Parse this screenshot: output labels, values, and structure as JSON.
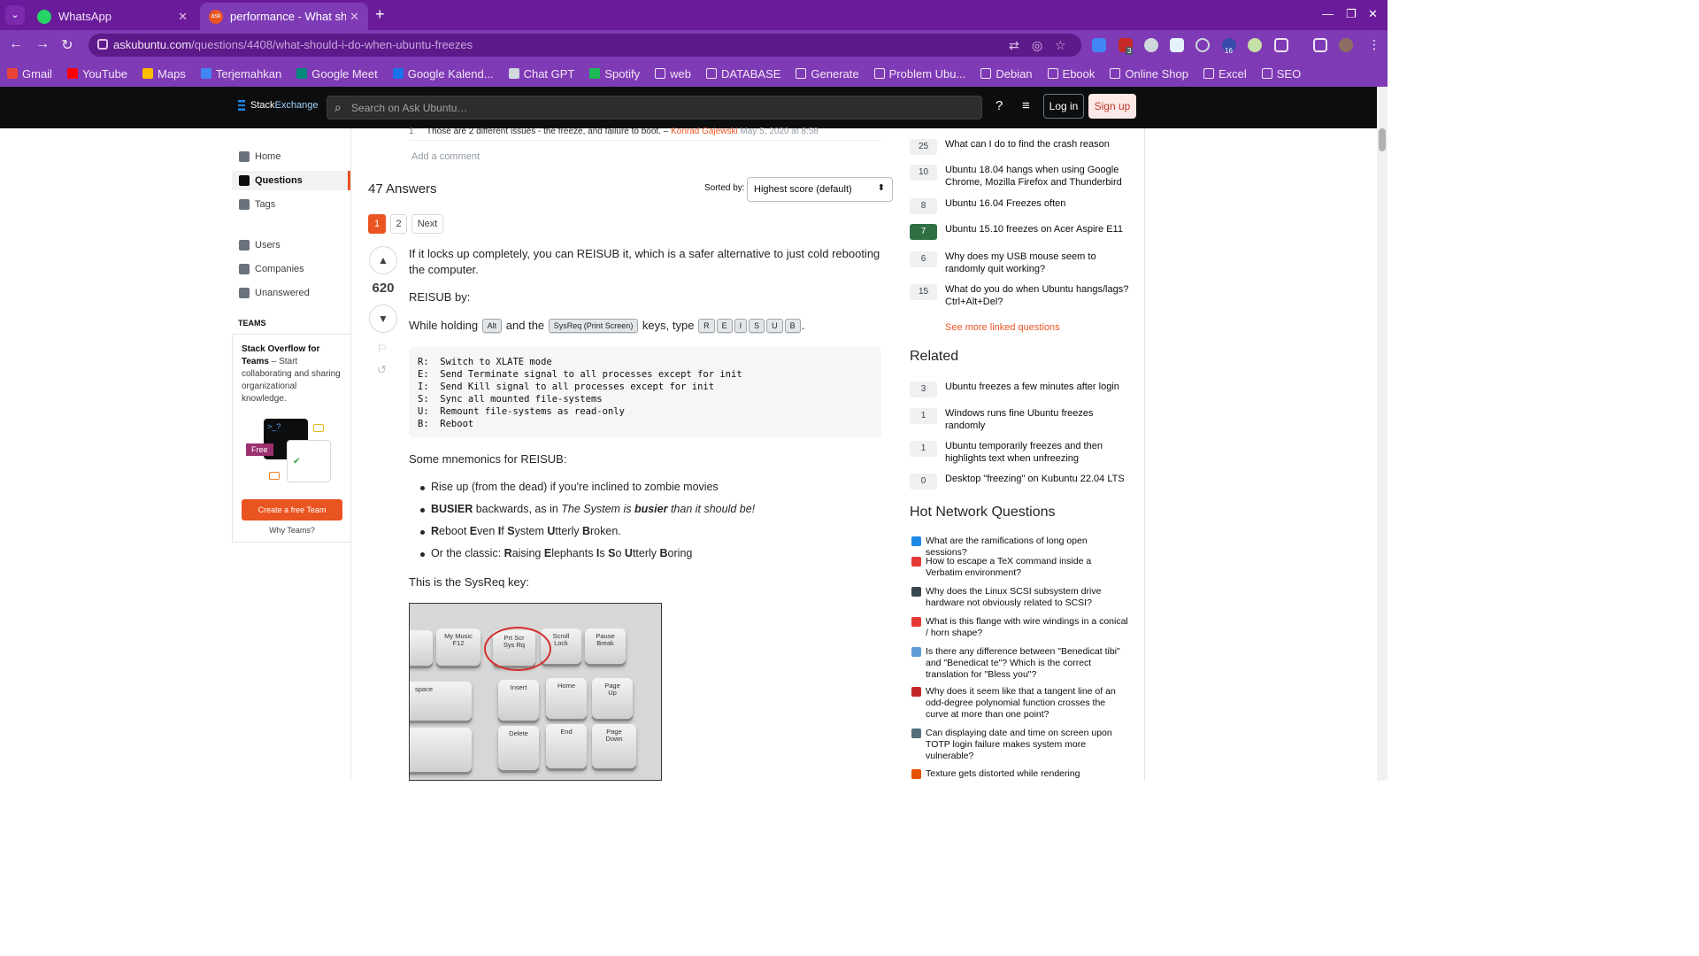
{
  "browser": {
    "tabs": [
      {
        "title": "WhatsApp",
        "active": false
      },
      {
        "title": "performance - What sho",
        "active": true
      }
    ],
    "url_host": "askubuntu.com",
    "url_path": "/questions/4408/what-should-i-do-when-ubuntu-freezes",
    "ext_badges": [
      "3",
      "16"
    ],
    "bookmarks": [
      {
        "label": "Gmail",
        "color": "#ea4335"
      },
      {
        "label": "YouTube",
        "color": "#ff0000"
      },
      {
        "label": "Maps",
        "color": "#fbbc04"
      },
      {
        "label": "Terjemahkan",
        "color": "#4285f4"
      },
      {
        "label": "Google Meet",
        "color": "#00897b"
      },
      {
        "label": "Google Kalend...",
        "color": "#1a73e8"
      },
      {
        "label": "Chat GPT",
        "color": "#cfd8dc"
      },
      {
        "label": "Spotify",
        "color": "#1db954"
      },
      {
        "label": "web",
        "folder": true
      },
      {
        "label": "DATABASE",
        "folder": true
      },
      {
        "label": "Generate",
        "folder": true
      },
      {
        "label": "Problem Ubu...",
        "folder": true
      },
      {
        "label": "Debian",
        "folder": true
      },
      {
        "label": "Ebook",
        "folder": true
      },
      {
        "label": "Online Shop",
        "folder": true
      },
      {
        "label": "Excel",
        "folder": true
      },
      {
        "label": "SEO",
        "folder": true
      }
    ]
  },
  "se": {
    "logo_stack": "Stack",
    "logo_exchange": "Exchange",
    "search_placeholder": "Search on Ask Ubuntu…",
    "login": "Log in",
    "signup": "Sign up"
  },
  "leftnav": {
    "home": "Home",
    "questions": "Questions",
    "tags": "Tags",
    "users": "Users",
    "companies": "Companies",
    "unanswered": "Unanswered",
    "teams_heading": "TEAMS",
    "teams_title": "Stack Overflow for Teams",
    "teams_body": " – Start collaborating and sharing organizational knowledge.",
    "teams_free": "Free",
    "teams_prompt": ">_?",
    "teams_button": "Create a free Team",
    "why_teams": "Why Teams?"
  },
  "comment": {
    "score": "1",
    "text": "Those are 2 different issues - the freeze, and failure to boot. – ",
    "user": "Konrad Gajewski",
    "date": " May 5, 2020 at 8:58",
    "add": "Add a comment"
  },
  "answers": {
    "heading": "47 Answers",
    "sorted_by": "Sorted by:",
    "sort_value": "Highest score (default)",
    "pages": [
      "1",
      "2",
      "Next"
    ]
  },
  "answer": {
    "votes": "620",
    "p1": "If it locks up completely, you can REISUB it, which is a safer alternative to just cold rebooting the computer.",
    "p2": "REISUB by:",
    "p3_a": "While holding ",
    "p3_b": " and the ",
    "p3_c": " keys, type ",
    "kbd_alt": "Alt",
    "kbd_sysreq": "SysReq (Print Screen)",
    "kbd_letters": [
      "R",
      "E",
      "I",
      "S",
      "U",
      "B"
    ],
    "code": "R:  Switch to XLATE mode\nE:  Send Terminate signal to all processes except for init\nI:  Send Kill signal to all processes except for init\nS:  Sync all mounted file-systems\nU:  Remount file-systems as read-only\nB:  Reboot",
    "p4": "Some mnemonics for REISUB:",
    "li1": "Rise up (from the dead) if you're inclined to zombie movies",
    "li2_busier": "BUSIER",
    "li2_rest": " backwards, as in ",
    "li2_italic1": "The System is ",
    "li2_bold": "busier",
    "li2_italic2": " than it should be!",
    "li3_parts": [
      [
        "R",
        "eboot "
      ],
      [
        "E",
        "ven "
      ],
      [
        "I",
        "f "
      ],
      [
        "S",
        "ystem "
      ],
      [
        "U",
        "tterly "
      ],
      [
        "B",
        "roken."
      ]
    ],
    "li4_prefix": "Or the classic: ",
    "li4_parts": [
      [
        "R",
        "aising "
      ],
      [
        "E",
        "lephants "
      ],
      [
        "I",
        "s "
      ],
      [
        "S",
        "o "
      ],
      [
        "U",
        "tterly "
      ],
      [
        "B",
        "oring"
      ]
    ],
    "p5": "This is the SysReq key:",
    "photo_keys": {
      "f12": "F12",
      "mymusic": "My Music",
      "prtscr": "Prt Scr\nSys Rq",
      "scroll": "Scroll\nLock",
      "pause": "Pause\nBreak",
      "space": "space",
      "insert": "Insert",
      "home": "Home",
      "pageup": "Page\nUp",
      "delete": "Delete",
      "end": "End",
      "pagedown": "Page\nDown"
    }
  },
  "linked": [
    {
      "score": "25",
      "q": "What can I do to find the crash reason"
    },
    {
      "score": "10",
      "q": "Ubuntu 18.04 hangs when using Google Chrome, Mozilla Firefox and Thunderbird"
    },
    {
      "score": "8",
      "q": "Ubuntu 16.04 Freezes often"
    },
    {
      "score": "7",
      "q": "Ubuntu 15.10 freezes on Acer Aspire E11",
      "accepted": true
    },
    {
      "score": "6",
      "q": "Why does my USB mouse seem to randomly quit working?"
    },
    {
      "score": "15",
      "q": "What do you do when Ubuntu hangs/lags? Ctrl+Alt+Del?"
    }
  ],
  "see_more": "See more linked questions",
  "related_heading": "Related",
  "related": [
    {
      "score": "3",
      "q": "Ubuntu freezes a few minutes after login"
    },
    {
      "score": "1",
      "q": "Windows runs fine Ubuntu freezes randomly"
    },
    {
      "score": "1",
      "q": "Ubuntu temporarily freezes and then highlights text when unfreezing"
    },
    {
      "score": "0",
      "q": "Desktop \"freezing\" on Kubuntu 22.04 LTS"
    }
  ],
  "hnq_heading": "Hot Network Questions",
  "hnq": [
    {
      "q": "What are the ramifications of long open sessions?",
      "color": "#1e88e5"
    },
    {
      "q": "How to escape a TeX command inside a Verbatim environment?",
      "color": "#e53935"
    },
    {
      "q": "Why does the Linux SCSI subsystem drive hardware not obviously related to SCSI?",
      "color": "#37474f"
    },
    {
      "q": "What is this flange with wire windings in a conical / horn shape?",
      "color": "#e53935"
    },
    {
      "q": "Is there any difference between \"Benedicat tibi\" and \"Benedicat te\"? Which is the correct translation for \"Bless you\"?",
      "color": "#5c9bd6"
    },
    {
      "q": "Why does it seem like that a tangent line of an odd-degree polynomial function crosses the curve at more than one point?",
      "color": "#c62828"
    },
    {
      "q": "Can displaying date and time on screen upon TOTP login failure makes system more vulnerable?",
      "color": "#546e7a"
    },
    {
      "q": "Texture gets distorted while rendering",
      "color": "#e65100"
    }
  ]
}
